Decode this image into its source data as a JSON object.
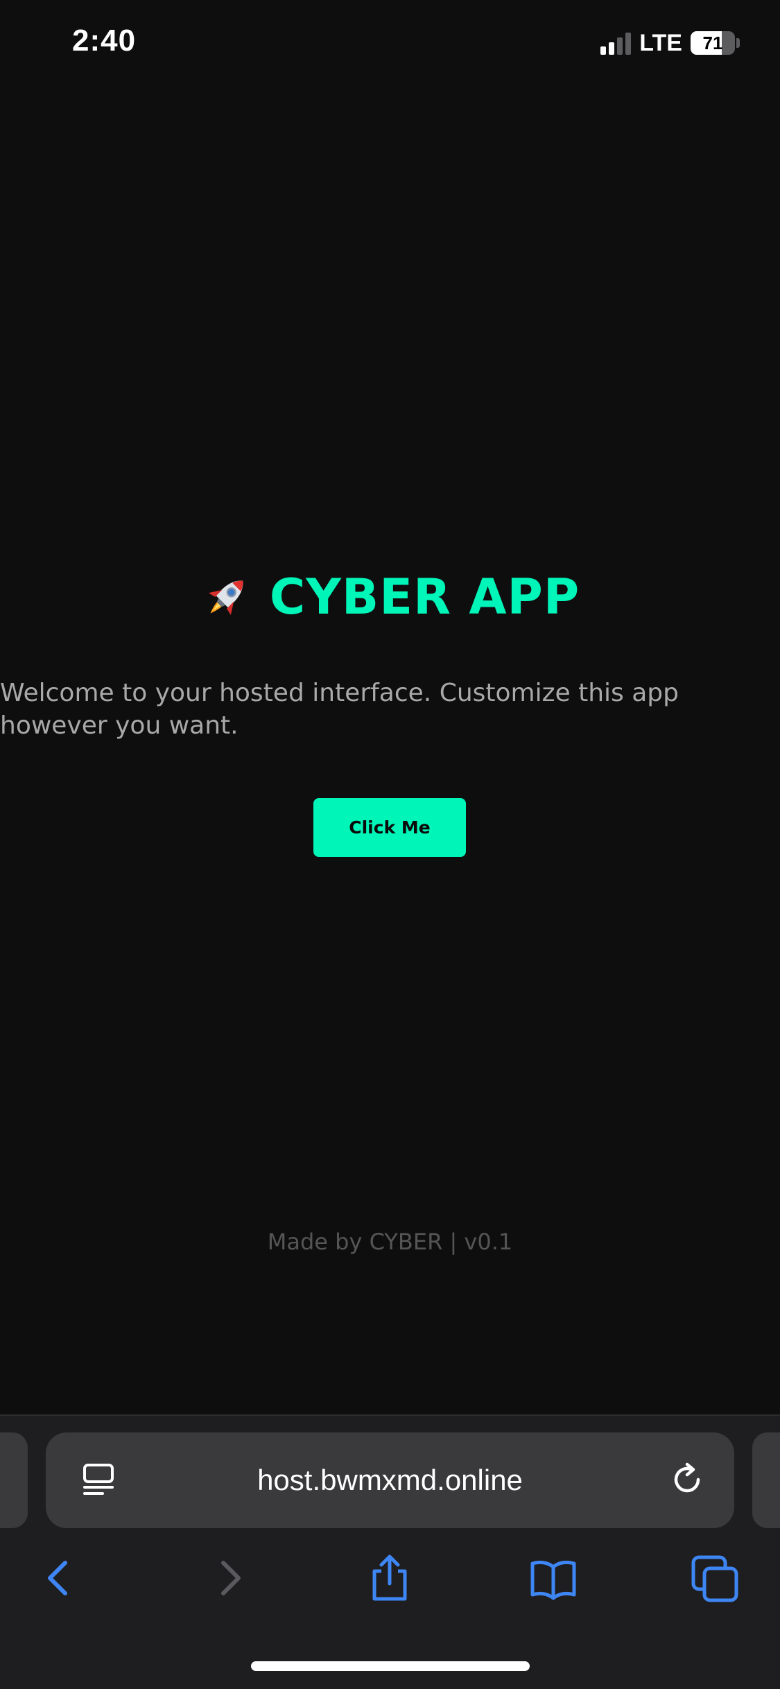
{
  "status_bar": {
    "time": "2:40",
    "network": "LTE",
    "battery_level": "71",
    "signal_bars_active": 2,
    "signal_bars_total": 4
  },
  "page": {
    "title": "CYBER APP",
    "title_icon": "rocket-icon",
    "welcome_text": "Welcome to your hosted interface. Customize this app however you want.",
    "button_label": "Click Me",
    "footer": "Made by CYBER | v0.1"
  },
  "browser": {
    "url": "host.bwmxmd.online",
    "page_menu_icon": "page-menu-icon",
    "reload_icon": "reload-icon",
    "nav": {
      "back_icon": "back-icon",
      "forward_icon": "forward-icon",
      "share_icon": "share-icon",
      "bookmarks_icon": "bookmarks-icon",
      "tabs_icon": "tabs-icon"
    }
  },
  "colors": {
    "background": "#0e0e0f",
    "accent": "#00f5b8",
    "body_text": "#a9a9a9",
    "footer_text": "#555555",
    "toolbar": "#1e1e20",
    "url_bar": "#3a3a3c",
    "ios_blue": "#3f86f5"
  }
}
